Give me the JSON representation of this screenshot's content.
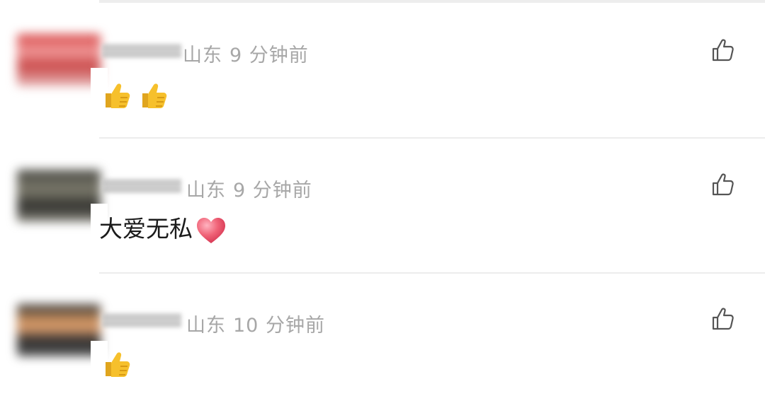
{
  "comments": [
    {
      "location": "山东",
      "time": "9 分钟前",
      "text": "",
      "emoji": [
        "thumbs-up",
        "thumbs-up"
      ]
    },
    {
      "location": "山东",
      "time": "9 分钟前",
      "text": "大爱无私",
      "emoji": [
        "red-heart"
      ]
    },
    {
      "location": "山东",
      "time": "10 分钟前",
      "text": "",
      "emoji": [
        "thumbs-up"
      ]
    }
  ],
  "icons": {
    "like": "thumbs-up-outline-icon"
  },
  "colors": {
    "meta_text": "#a7a7a7",
    "body_text": "#1b1b1b",
    "divider": "#ececec",
    "emoji_yellow": "#f6c02c",
    "heart_pink": "#f06478"
  }
}
